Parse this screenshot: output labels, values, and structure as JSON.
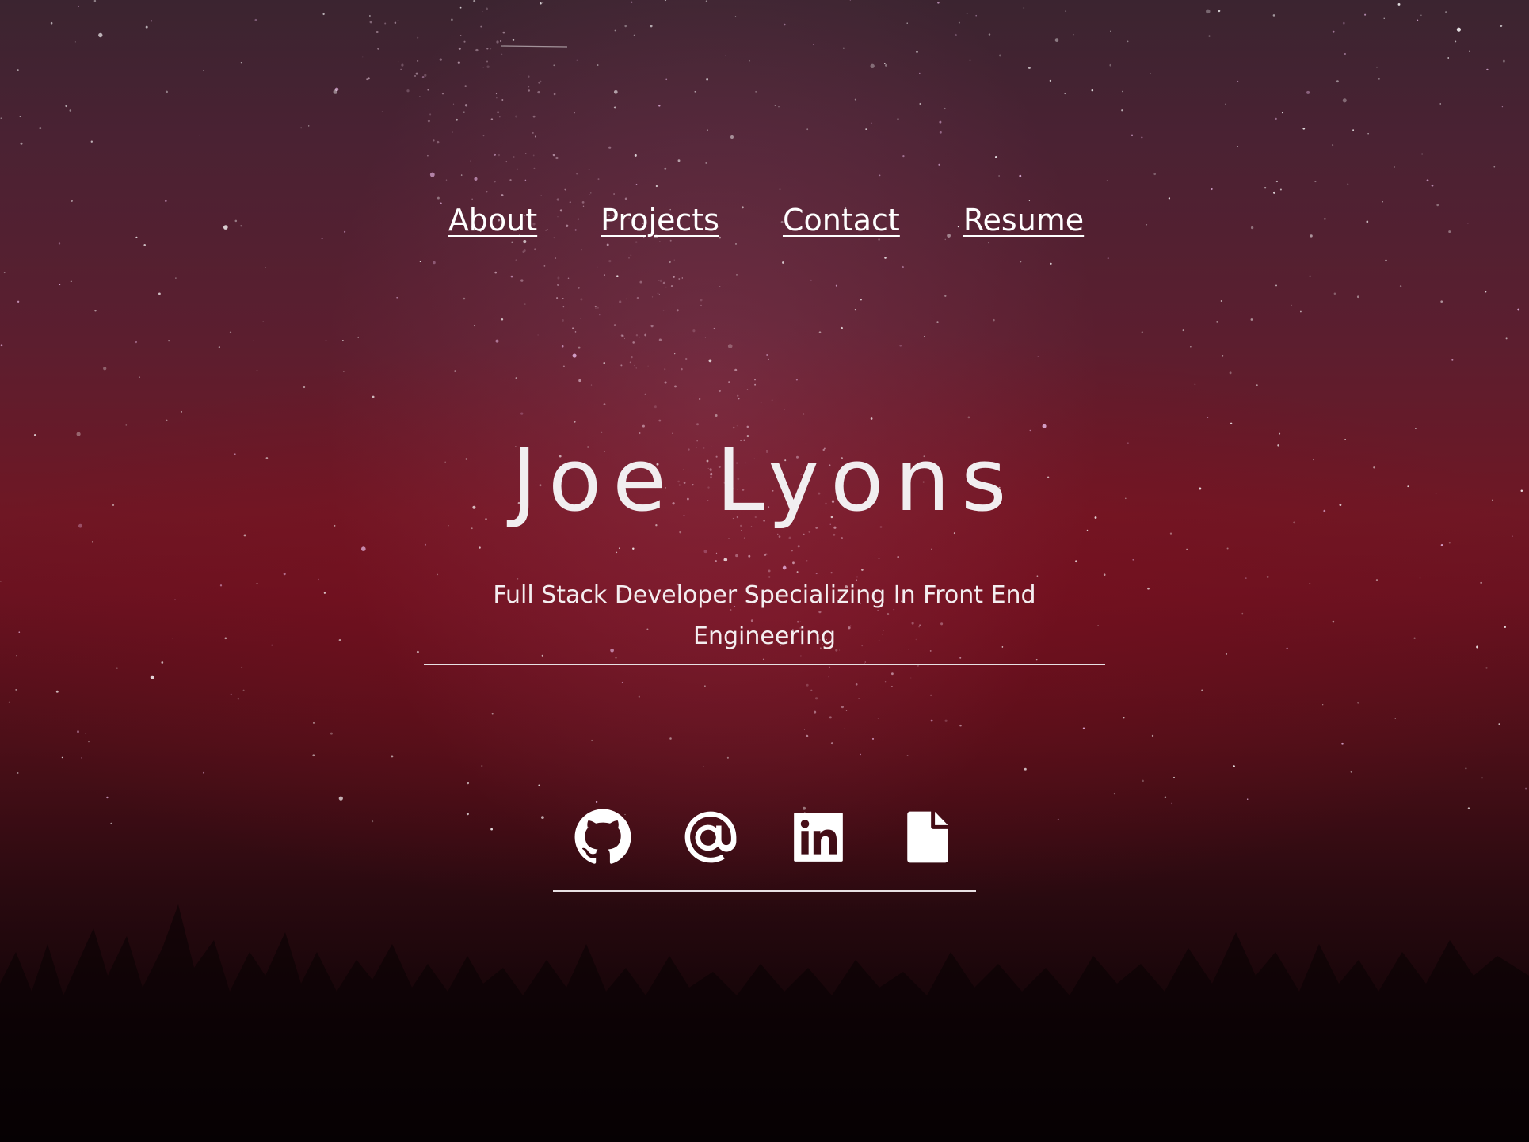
{
  "nav": {
    "items": [
      {
        "label": "About"
      },
      {
        "label": "Projects"
      },
      {
        "label": "Contact"
      },
      {
        "label": "Resume"
      }
    ]
  },
  "hero": {
    "name": "Joe Lyons",
    "subtitle": "Full Stack Developer Specializing In Front End Engineering"
  },
  "socials": {
    "icons": [
      "github-icon",
      "email-at-icon",
      "linkedin-icon",
      "resume-file-icon"
    ]
  },
  "colors": {
    "text": "#ffffff",
    "accent_red": "#6f1724",
    "sky_top": "#3b2430",
    "ground": "#060103"
  }
}
